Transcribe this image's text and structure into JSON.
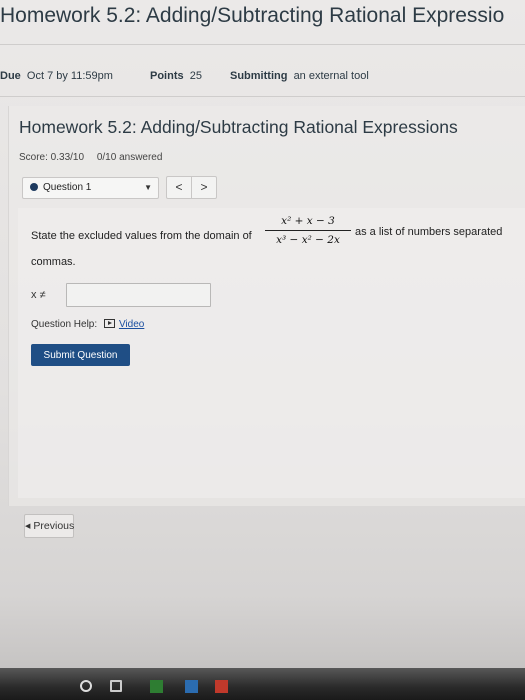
{
  "header": {
    "course_title": "Homework 5.2: Adding/Subtracting Rational Expressio"
  },
  "meta": {
    "due_label": "Due",
    "due_value": "Oct 7 by 11:59pm",
    "points_label": "Points",
    "points_value": "25",
    "submitting_label": "Submitting",
    "submitting_value": "an external tool"
  },
  "homework": {
    "title": "Homework 5.2: Adding/Subtracting Rational Expressions",
    "score": "Score: 0.33/10",
    "answered": "0/10 answered"
  },
  "question_nav": {
    "selected": "Question 1",
    "prev_label": "<",
    "next_label": ">"
  },
  "question": {
    "prompt_before": "State the excluded values from the domain of",
    "numerator": "x² + x − 3",
    "denominator": "x³ − x² − 2x",
    "prompt_after": "as a list of numbers separated",
    "prompt_continued": "commas.",
    "answer_label": "x ≠",
    "answer_value": "",
    "help_label": "Question Help:",
    "help_link": "Video",
    "submit_label": "Submit Question"
  },
  "footer": {
    "previous_label": "Previous"
  },
  "colors": {
    "submit_bg": "#1f4e85",
    "link": "#1b4fa0",
    "title_text": "#2d3b45"
  }
}
